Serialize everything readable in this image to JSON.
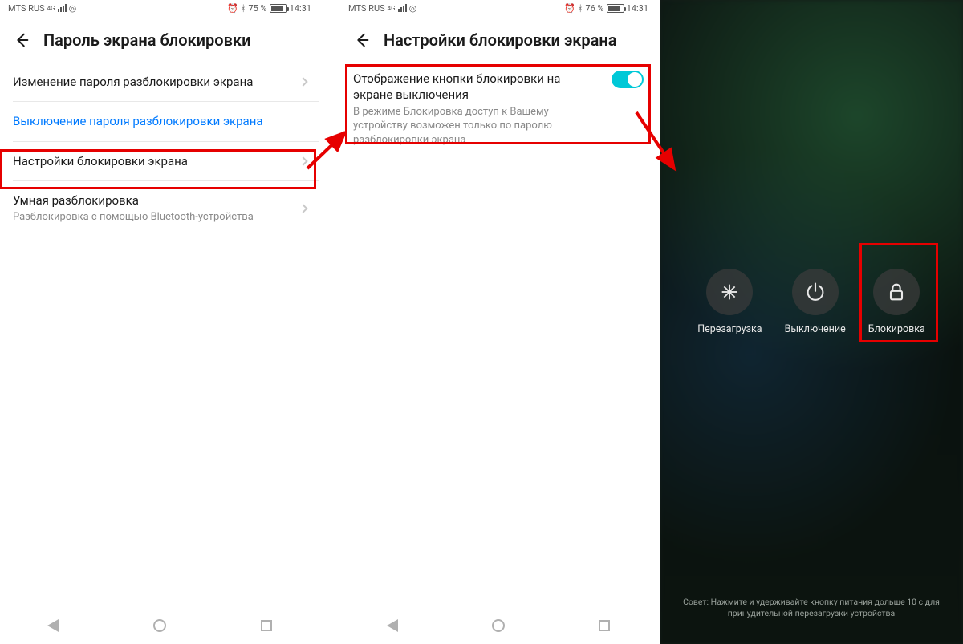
{
  "phone1": {
    "status": {
      "carrier": "MTS RUS",
      "net": "4G",
      "battery": "75 %",
      "time": "14:31"
    },
    "header": "Пароль экрана блокировки",
    "rows": {
      "change": "Изменение пароля разблокировки экрана",
      "disable": "Выключение пароля разблокировки экрана",
      "lock_settings": "Настройки блокировки экрана",
      "smart_title": "Умная разблокировка",
      "smart_sub": "Разблокировка с помощью Bluetooth-устройства"
    }
  },
  "phone2": {
    "status": {
      "carrier": "MTS RUS",
      "net": "4G",
      "battery": "76 %",
      "time": "14:31"
    },
    "header": "Настройки блокировки экрана",
    "toggle": {
      "title": "Отображение кнопки блокировки на экране выключения",
      "sub": "В режиме Блокировка доступ к Вашему устройству возможен только по паролю разблокировки экрана"
    }
  },
  "phone3": {
    "power": {
      "restart": "Перезагрузка",
      "off": "Выключение",
      "lock": "Блокировка"
    },
    "tip": "Совет: Нажмите и удерживайте кнопку питания дольше 10 с для принудительной перезагрузки устройства"
  },
  "icons": {
    "alarm": "⏰",
    "bt": "✱"
  }
}
